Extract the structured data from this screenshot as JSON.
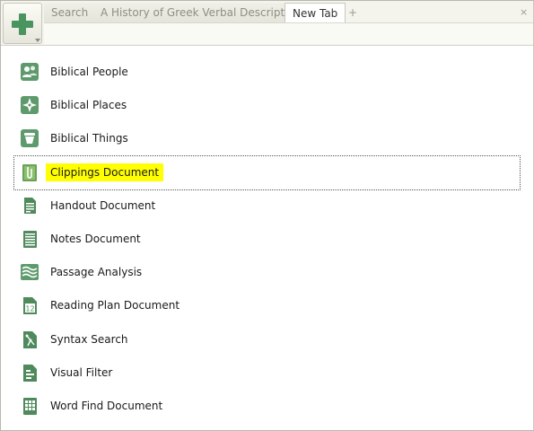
{
  "tabs": [
    {
      "label": "Search"
    },
    {
      "label": "A History of Greek Verbal Description"
    },
    {
      "label": "New Tab"
    }
  ],
  "tab_add_glyph": "+",
  "tab_close_glyph": "×",
  "items": [
    {
      "label": "Biblical People",
      "icon": "people-icon"
    },
    {
      "label": "Biblical Places",
      "icon": "compass-icon"
    },
    {
      "label": "Biblical Things",
      "icon": "vessel-icon"
    },
    {
      "label": "Clippings Document",
      "icon": "paperclip-icon"
    },
    {
      "label": "Handout Document",
      "icon": "handout-icon"
    },
    {
      "label": "Notes Document",
      "icon": "notes-icon"
    },
    {
      "label": "Passage Analysis",
      "icon": "waves-icon"
    },
    {
      "label": "Reading Plan Document",
      "icon": "calendar-icon"
    },
    {
      "label": "Syntax Search",
      "icon": "syntax-tree-icon"
    },
    {
      "label": "Visual Filter",
      "icon": "filter-icon"
    },
    {
      "label": "Word Find Document",
      "icon": "word-grid-icon"
    }
  ],
  "colors": {
    "icon_green": "#4f8a5c",
    "highlight": "#ffff00",
    "plus_green": "#4a9460"
  }
}
